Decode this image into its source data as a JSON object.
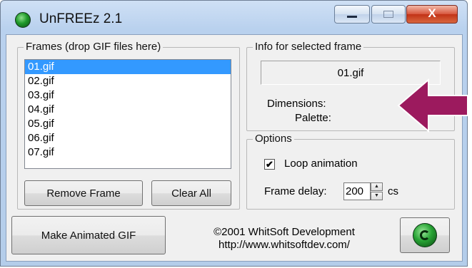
{
  "window": {
    "title": "UnFREEz 2.1",
    "minimize_icon": "minimize-icon",
    "maximize_icon": "maximize-icon",
    "close_icon": "close-icon",
    "close_glyph": "X"
  },
  "frames": {
    "label": "Frames (drop GIF files here)",
    "items": [
      "01.gif",
      "02.gif",
      "03.gif",
      "04.gif",
      "05.gif",
      "06.gif",
      "07.gif"
    ],
    "selected_index": 0,
    "remove_label": "Remove Frame",
    "clear_label": "Clear All"
  },
  "info": {
    "label": "Info for selected frame",
    "frame_name": "01.gif",
    "dimensions_label": "Dimensions:",
    "palette_label": "Palette:"
  },
  "options": {
    "label": "Options",
    "loop_checked": true,
    "loop_label": "Loop animation",
    "delay_label": "Frame delay:",
    "delay_value": "200",
    "delay_unit": "cs"
  },
  "footer": {
    "make_label": "Make Animated GIF",
    "copyright_line1": "©2001 WhitSoft Development",
    "copyright_line2": "http://www.whitsoftdev.com/"
  },
  "annotation": {
    "arrow_color": "#9c1a5e",
    "icon": "left-arrow-icon"
  }
}
